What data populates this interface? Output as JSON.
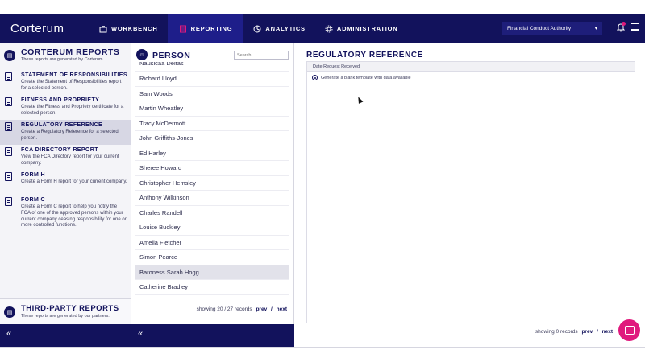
{
  "app": {
    "brand": "Corterum",
    "nav": [
      {
        "label": "WORKBENCH",
        "icon": "briefcase-icon"
      },
      {
        "label": "REPORTING",
        "icon": "report-icon"
      },
      {
        "label": "ANALYTICS",
        "icon": "pie-chart-icon"
      },
      {
        "label": "ADMINISTRATION",
        "icon": "gear-icon"
      }
    ],
    "active_nav": "REPORTING",
    "org_select": "Financial Conduct Authority",
    "notification_badge": true,
    "colors": {
      "navy": "#12125c",
      "accent": "#e0197d",
      "active_row": "#d7d7e4"
    }
  },
  "left": {
    "title": "CORTERUM REPORTS",
    "subtitle": "These reports are generated by Corterum",
    "reports": [
      {
        "title": "STATEMENT OF RESPONSIBILITIES",
        "desc": "Create the Statement of Responsibilities report for a selected person."
      },
      {
        "title": "FITNESS AND PROPRIETY",
        "desc": "Create the Fitness and Propriety certificate for a selected person."
      },
      {
        "title": "REGULATORY REFERENCE",
        "desc": "Create a Regulatory Reference for a selected person."
      },
      {
        "title": "FCA DIRECTORY REPORT",
        "desc": "View the FCA Directory report for your current company."
      },
      {
        "title": "FORM H",
        "desc": "Create a Form H report for your current company."
      },
      {
        "title": "FORM C",
        "desc": "Create a Form C report to help you notify the FCA of one of the approved persons within your current company ceasing responsibility for one or more controlled functions."
      }
    ],
    "third_party_title": "THIRD-PARTY REPORTS",
    "third_party_subtitle": "These reports are generated by our partners.",
    "collapse": "«"
  },
  "middle": {
    "title": "PERSON",
    "search_placeholder": "Search...",
    "people": [
      "Nausicaa Delfas",
      "Richard Lloyd",
      "Sam Woods",
      "Martin Wheatley",
      "Tracy McDermott",
      "John Griffiths-Jones",
      "Ed Harley",
      "Sheree Howard",
      "Christopher Hemsley",
      "Anthony Wilkinson",
      "Charles Randell",
      "Louise Buckley",
      "Amelia Fletcher",
      "Simon Pearce",
      "Baroness Sarah Hogg",
      "Catherine Bradley"
    ],
    "selected": "Baroness Sarah Hogg",
    "pager": {
      "text": "showing 20 / 27 records",
      "prev": "prev",
      "sep": "/",
      "next": "next"
    },
    "collapse": "«"
  },
  "right": {
    "title": "REGULATORY REFERENCE",
    "table_header": "Date Request Received",
    "row_option": "Generate a blank template with data available",
    "pager": {
      "text": "showing 0 records",
      "prev": "prev",
      "sep": "/",
      "next": "next"
    }
  }
}
